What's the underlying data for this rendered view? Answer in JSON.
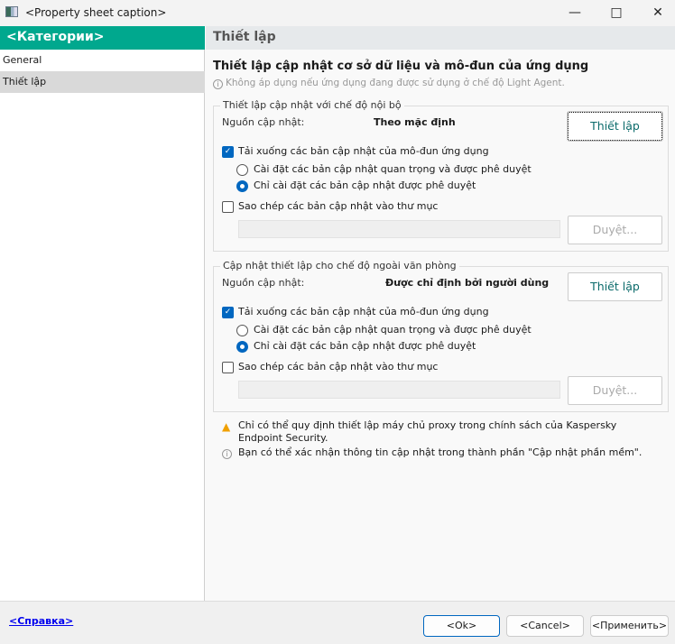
{
  "window": {
    "caption": "<Property sheet caption>"
  },
  "sidebar": {
    "header": "<Категории>",
    "items": [
      {
        "label": "General"
      },
      {
        "label": "Thiết lập"
      }
    ]
  },
  "main": {
    "header": "Thiết lập",
    "title": "Thiết lập cập nhật cơ sở dữ liệu và mô-đun của ứng dụng",
    "subtitle": "Không áp dụng nếu ứng dụng đang được sử dụng ở chế độ Light Agent.",
    "groups": [
      {
        "title": "Thiết lập cập nhật với chế độ nội bộ",
        "source_label": "Nguồn cập nhật:",
        "source_value": "Theo mặc định",
        "settings_button": "Thiết lập",
        "download_label": "Tải xuống các bản cập nhật của mô-đun ứng dụng",
        "download_checked": true,
        "radio1": "Cài đặt các bản cập nhật quan trọng và được phê duyệt",
        "radio2": "Chỉ cài đặt các bản cập nhật được phê duyệt",
        "selected_radio": 2,
        "copy_label": "Sao chép các bản cập nhật vào thư mục",
        "copy_checked": false,
        "folder_value": "",
        "browse_button": "Duyệt..."
      },
      {
        "title": "Cập nhật thiết lập cho chế độ ngoài văn phòng",
        "source_label": "Nguồn cập nhật:",
        "source_value": "Được chỉ định bởi người dùng",
        "settings_button": "Thiết lập",
        "download_label": "Tải xuống các bản cập nhật của mô-đun ứng dụng",
        "download_checked": true,
        "radio1": "Cài đặt các bản cập nhật quan trọng và được phê duyệt",
        "radio2": "Chỉ cài đặt các bản cập nhật được phê duyệt",
        "selected_radio": 2,
        "copy_label": "Sao chép các bản cập nhật vào thư mục",
        "copy_checked": false,
        "folder_value": "",
        "browse_button": "Duyệt..."
      }
    ],
    "warning": "Chỉ có thể quy định thiết lập máy chủ proxy trong chính sách của Kaspersky Endpoint Security.",
    "note": "Bạn có thể xác nhận thông tin cập nhật trong thành phần \"Cập nhật phần mềm\"."
  },
  "footer": {
    "help": "<Справка>",
    "ok": "<Ok>",
    "cancel": "<Cancel>",
    "apply": "<Применить>"
  },
  "colors": {
    "accent": "#00a88e",
    "check": "#0067c0"
  }
}
